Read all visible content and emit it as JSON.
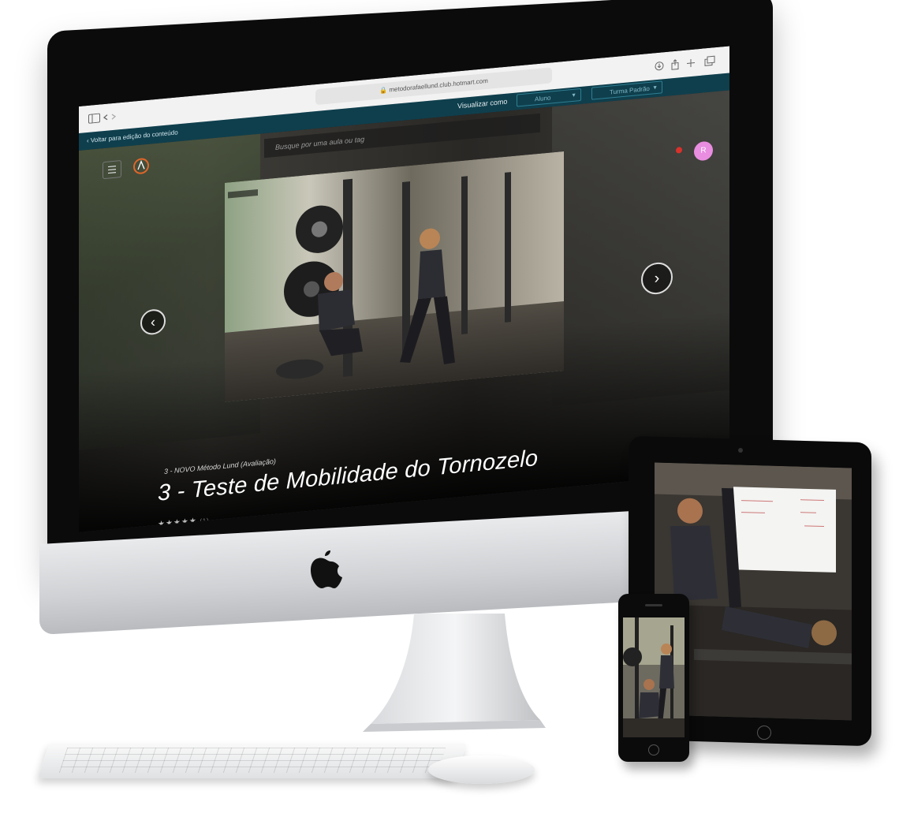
{
  "browser": {
    "url": "metodorafaellund.club.hotmart.com"
  },
  "app_bar": {
    "back_link": "Voltar para edição do conteúdo",
    "view_as_label": "Visualizar como",
    "role_select": "Aluno",
    "class_select": "Turma Padrão"
  },
  "header": {
    "search_placeholder": "Busque por uma aula ou tag",
    "avatar_initial": "R",
    "notification_count": "1"
  },
  "hero": {
    "module": "3 - NOVO Método Lund (Avaliação)",
    "title": "3 - Teste de Mobilidade do Tornozelo",
    "stars": "★★★★★",
    "rating_count": "(1)"
  },
  "colors": {
    "app_bar": "#0f3f4d",
    "avatar": "#e98de0",
    "badge": "#d9312b"
  }
}
